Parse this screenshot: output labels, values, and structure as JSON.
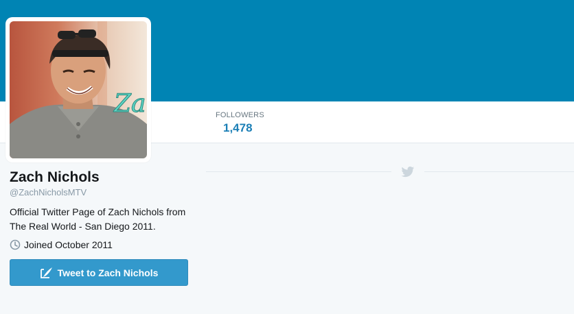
{
  "header": {
    "banner_color": "#0084b4"
  },
  "stats": {
    "followers_label": "FOLLOWERS",
    "followers_value": "1,478"
  },
  "profile": {
    "name": "Zach Nichols",
    "handle": "@ZachNicholsMTV",
    "bio": "Official Twitter Page of Zach Nichols from The Real World - San Diego 2011.",
    "joined": "Joined October 2011",
    "avatar_overlay_text": "Za"
  },
  "actions": {
    "tweet_to_label": "Tweet to Zach Nichols"
  },
  "icons": {
    "clock": "clock-icon",
    "compose": "compose-tweet-icon",
    "bird": "twitter-bird-icon"
  },
  "colors": {
    "accent": "#3399cc",
    "stat_value": "#1b7fb6"
  }
}
